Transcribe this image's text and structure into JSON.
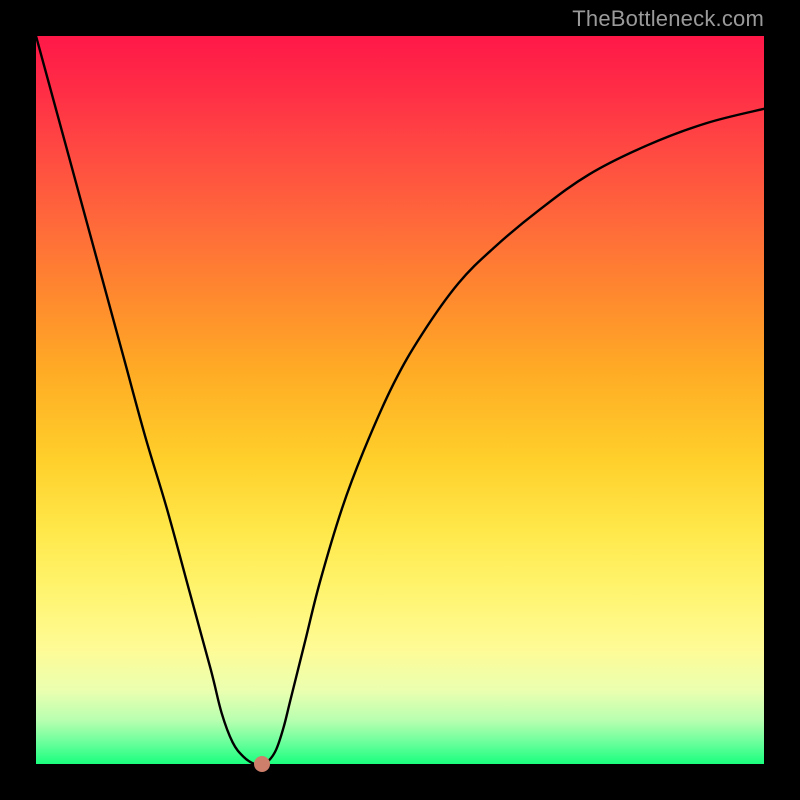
{
  "watermark": "TheBottleneck.com",
  "chart_data": {
    "type": "line",
    "title": "",
    "xlabel": "",
    "ylabel": "",
    "xlim": [
      0,
      100
    ],
    "ylim": [
      0,
      100
    ],
    "series": [
      {
        "name": "curve",
        "x": [
          0,
          3,
          6,
          9,
          12,
          15,
          18,
          21,
          24,
          25.5,
          27,
          28.5,
          30,
          31,
          32,
          33,
          34,
          35,
          37,
          39,
          42,
          45,
          49,
          53,
          58,
          63,
          69,
          76,
          84,
          92,
          100
        ],
        "y": [
          100,
          89,
          78,
          67,
          56,
          45,
          35,
          24,
          13,
          7,
          3,
          1,
          0,
          0,
          0.5,
          2,
          5,
          9,
          17,
          25,
          35,
          43,
          52,
          59,
          66,
          71,
          76,
          81,
          85,
          88,
          90
        ]
      }
    ],
    "marker": {
      "x": 31,
      "y": 0,
      "color": "#cd7f6b"
    },
    "background_gradient": [
      "#ff1848",
      "#ff8a2e",
      "#ffe84a",
      "#fffb95",
      "#1aff7e"
    ]
  }
}
